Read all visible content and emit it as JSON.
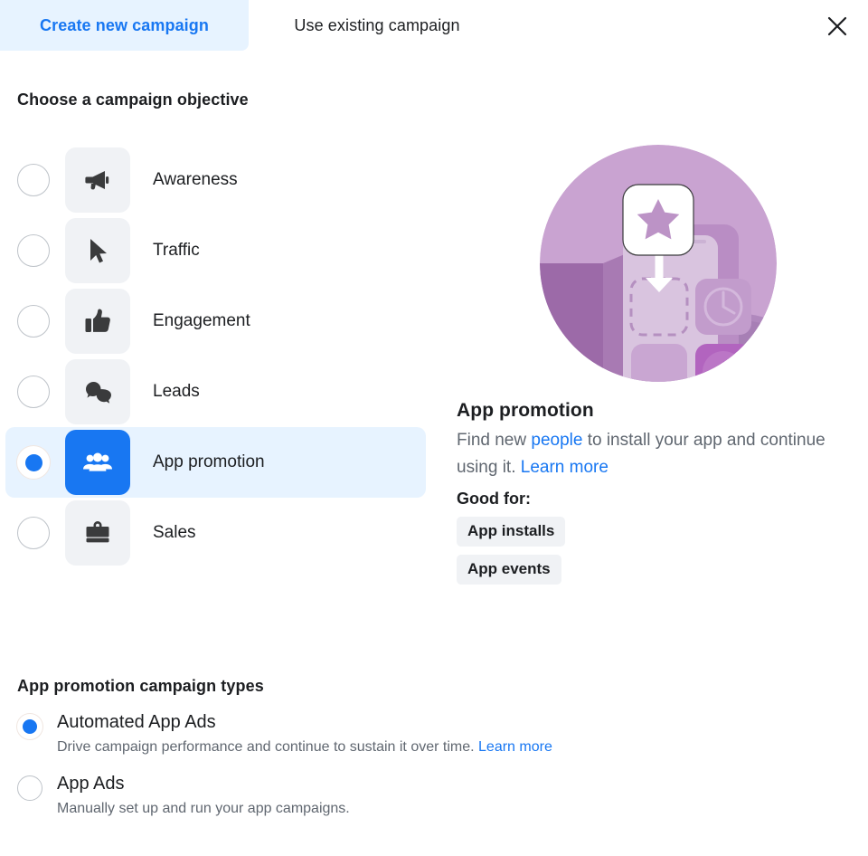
{
  "tabs": [
    {
      "label": "Create new campaign",
      "active": true
    },
    {
      "label": "Use existing campaign",
      "active": false
    }
  ],
  "close_icon": "close-icon",
  "objective_section": {
    "title": "Choose a campaign objective",
    "items": [
      {
        "label": "Awareness",
        "icon": "megaphone-icon",
        "selected": false
      },
      {
        "label": "Traffic",
        "icon": "cursor-icon",
        "selected": false
      },
      {
        "label": "Engagement",
        "icon": "thumbs-up-icon",
        "selected": false
      },
      {
        "label": "Leads",
        "icon": "speech-bubbles-icon",
        "selected": false
      },
      {
        "label": "App promotion",
        "icon": "people-group-icon",
        "selected": true
      },
      {
        "label": "Sales",
        "icon": "briefcase-icon",
        "selected": false
      }
    ]
  },
  "info_panel": {
    "illustration": "app-promotion-illustration",
    "title": "App promotion",
    "description_part1": "Find new ",
    "description_link1": "people",
    "description_part2": " to install your app and continue using it. ",
    "description_link2": "Learn more",
    "good_for_label": "Good for:",
    "badges": [
      "App installs",
      "App events"
    ]
  },
  "types_section": {
    "title": "App promotion campaign types",
    "items": [
      {
        "name": "Automated App Ads",
        "desc": "Drive campaign performance and continue to sustain it over time. ",
        "link": "Learn more",
        "selected": true
      },
      {
        "name": "App Ads",
        "desc": "Manually set up and run your app campaigns.",
        "link": "",
        "selected": false
      }
    ]
  },
  "colors": {
    "accent_blue": "#1877f2",
    "selected_row_bg": "#e7f3ff",
    "tile_gray": "#f0f2f5",
    "text_primary": "#1c1e21",
    "text_secondary": "#606770",
    "illustration_purple": "#c8a0d0",
    "illustration_purple_dark": "#9c6aa8"
  }
}
